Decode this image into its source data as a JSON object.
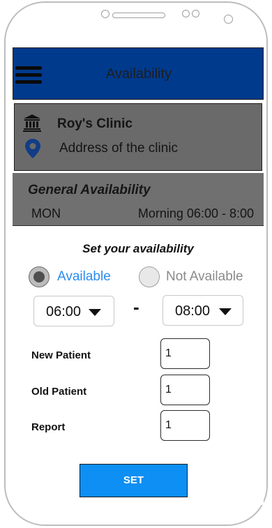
{
  "header": {
    "title": "Availability",
    "menu_icon": "hamburger-menu-icon",
    "color": "#003a8c"
  },
  "clinic": {
    "name": "Roy's Clinic",
    "address": "Address of the clinic",
    "name_icon": "bank-building-icon",
    "address_icon": "location-pin-icon"
  },
  "general": {
    "title": "General Availability",
    "day": "MON",
    "time": "Morning 06:00 - 8:00"
  },
  "dialog": {
    "title": "Set your availability",
    "radio": {
      "available_label": "Available",
      "not_available_label": "Not Available",
      "selected": "Available",
      "accent": "#2a8cf0"
    },
    "from_time": "06:00",
    "separator": "-",
    "to_time": "08:00",
    "fields": [
      {
        "label": "New Patient",
        "value": "1"
      },
      {
        "label": "Old Patient",
        "value": "1"
      },
      {
        "label": "Report",
        "value": "1"
      }
    ],
    "set_label": "SET",
    "button_color": "#0d8ff4"
  }
}
